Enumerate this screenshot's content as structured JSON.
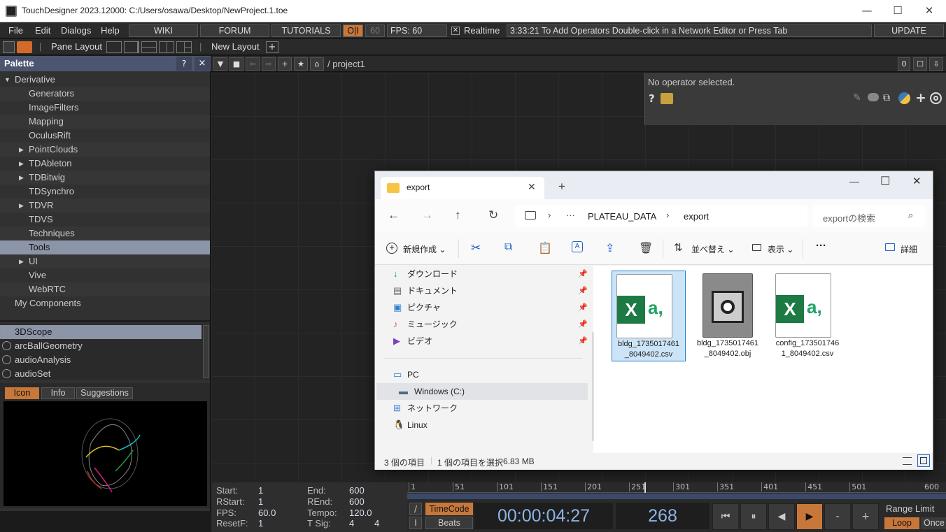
{
  "titlebar": {
    "title": "TouchDesigner 2023.12000: C:/Users/osawa/Desktop/NewProject.1.toe"
  },
  "menu": {
    "file": "File",
    "edit": "Edit",
    "dialogs": "Dialogs",
    "help": "Help",
    "wiki": "WIKI",
    "forum": "FORUM",
    "tutorials": "TUTORIALS",
    "oi": "O|I",
    "fps_cap": "60",
    "fps_label": "FPS:",
    "fps_value": "60",
    "realtime": "Realtime",
    "status": "3:33:21 To Add Operators Double-click in a Network Editor or Press Tab",
    "update": "UPDATE"
  },
  "panebar": {
    "pane_layout": "Pane Layout",
    "new_layout": "New Layout"
  },
  "palette": {
    "title": "Palette",
    "help": "?",
    "close": "×",
    "tree": [
      {
        "label": "Derivative",
        "level": 0,
        "arrow": "down"
      },
      {
        "label": "Generators",
        "level": 1,
        "arrow": ""
      },
      {
        "label": "ImageFilters",
        "level": 1,
        "arrow": ""
      },
      {
        "label": "Mapping",
        "level": 1,
        "arrow": ""
      },
      {
        "label": "OculusRift",
        "level": 1,
        "arrow": ""
      },
      {
        "label": "PointClouds",
        "level": 1,
        "arrow": "right"
      },
      {
        "label": "TDAbleton",
        "level": 1,
        "arrow": "right"
      },
      {
        "label": "TDBitwig",
        "level": 1,
        "arrow": "right"
      },
      {
        "label": "TDSynchro",
        "level": 1,
        "arrow": ""
      },
      {
        "label": "TDVR",
        "level": 1,
        "arrow": "right"
      },
      {
        "label": "TDVS",
        "level": 1,
        "arrow": ""
      },
      {
        "label": "Techniques",
        "level": 1,
        "arrow": ""
      },
      {
        "label": "Tools",
        "level": 1,
        "arrow": "",
        "selected": true
      },
      {
        "label": "UI",
        "level": 1,
        "arrow": "right"
      },
      {
        "label": "Vive",
        "level": 1,
        "arrow": ""
      },
      {
        "label": "WebRTC",
        "level": 1,
        "arrow": ""
      },
      {
        "label": "My Components",
        "level": 0,
        "arrow": ""
      }
    ],
    "components": [
      "3DScope",
      "arcBallGeometry",
      "audioAnalysis",
      "audioSet"
    ],
    "tabs": [
      "Icon",
      "Info",
      "Suggestions"
    ]
  },
  "network": {
    "path": "/ project1",
    "count": "0"
  },
  "opinfo": {
    "text": "No operator selected.",
    "help": "?"
  },
  "explorer": {
    "tab_title": "export",
    "new_tab": "+",
    "breadcrumb": [
      "PLATEAU_DATA",
      "export"
    ],
    "ellipsis": "···",
    "search_placeholder": "exportの検索",
    "cmd": {
      "new": "新規作成",
      "sort": "並べ替え",
      "view": "表示",
      "more": "···",
      "details": "詳細"
    },
    "quick_access": [
      "ダウンロード",
      "ドキュメント",
      "ピクチャ",
      "ミュージック",
      "ビデオ"
    ],
    "locations": [
      "PC",
      "Windows (C:)",
      "ネットワーク",
      "Linux"
    ],
    "files": [
      {
        "name": "bldg_1735017461_8049402.csv",
        "kind": "excel"
      },
      {
        "name": "bldg_1735017461_8049402.obj",
        "kind": "obj"
      },
      {
        "name": "config_1735017461_8049402.csv",
        "kind": "excel"
      }
    ],
    "file_labels": [
      [
        "bldg_1735017461",
        "_8049402.csv"
      ],
      [
        "bldg_1735017461",
        "_8049402.obj"
      ],
      [
        "config_173501746",
        "1_8049402.csv"
      ]
    ],
    "status_items": "3 個の項目",
    "status_selected": "1 個の項目を選択",
    "status_size": "6.83 MB"
  },
  "timeline": {
    "start_l": "Start:",
    "start": "1",
    "end_l": "End:",
    "end": "600",
    "rstart_l": "RStart:",
    "rstart": "1",
    "rend_l": "REnd:",
    "rend": "600",
    "fps_l": "FPS:",
    "fps": "60.0",
    "tempo_l": "Tempo:",
    "tempo": "120.0",
    "resetf_l": "ResetF:",
    "resetf": "1",
    "tsig_l": "T Sig:",
    "tsig_a": "4",
    "tsig_b": "4",
    "ticks": [
      "1",
      "51",
      "101",
      "151",
      "201",
      "251",
      "301",
      "351",
      "401",
      "451",
      "501",
      "600"
    ],
    "timecode_btn": "TimeCode",
    "beats_btn": "Beats",
    "timecode": "00:00:04:27",
    "frame": "268",
    "range_limit": "Range Limit",
    "loop": "Loop",
    "once": "Once"
  }
}
